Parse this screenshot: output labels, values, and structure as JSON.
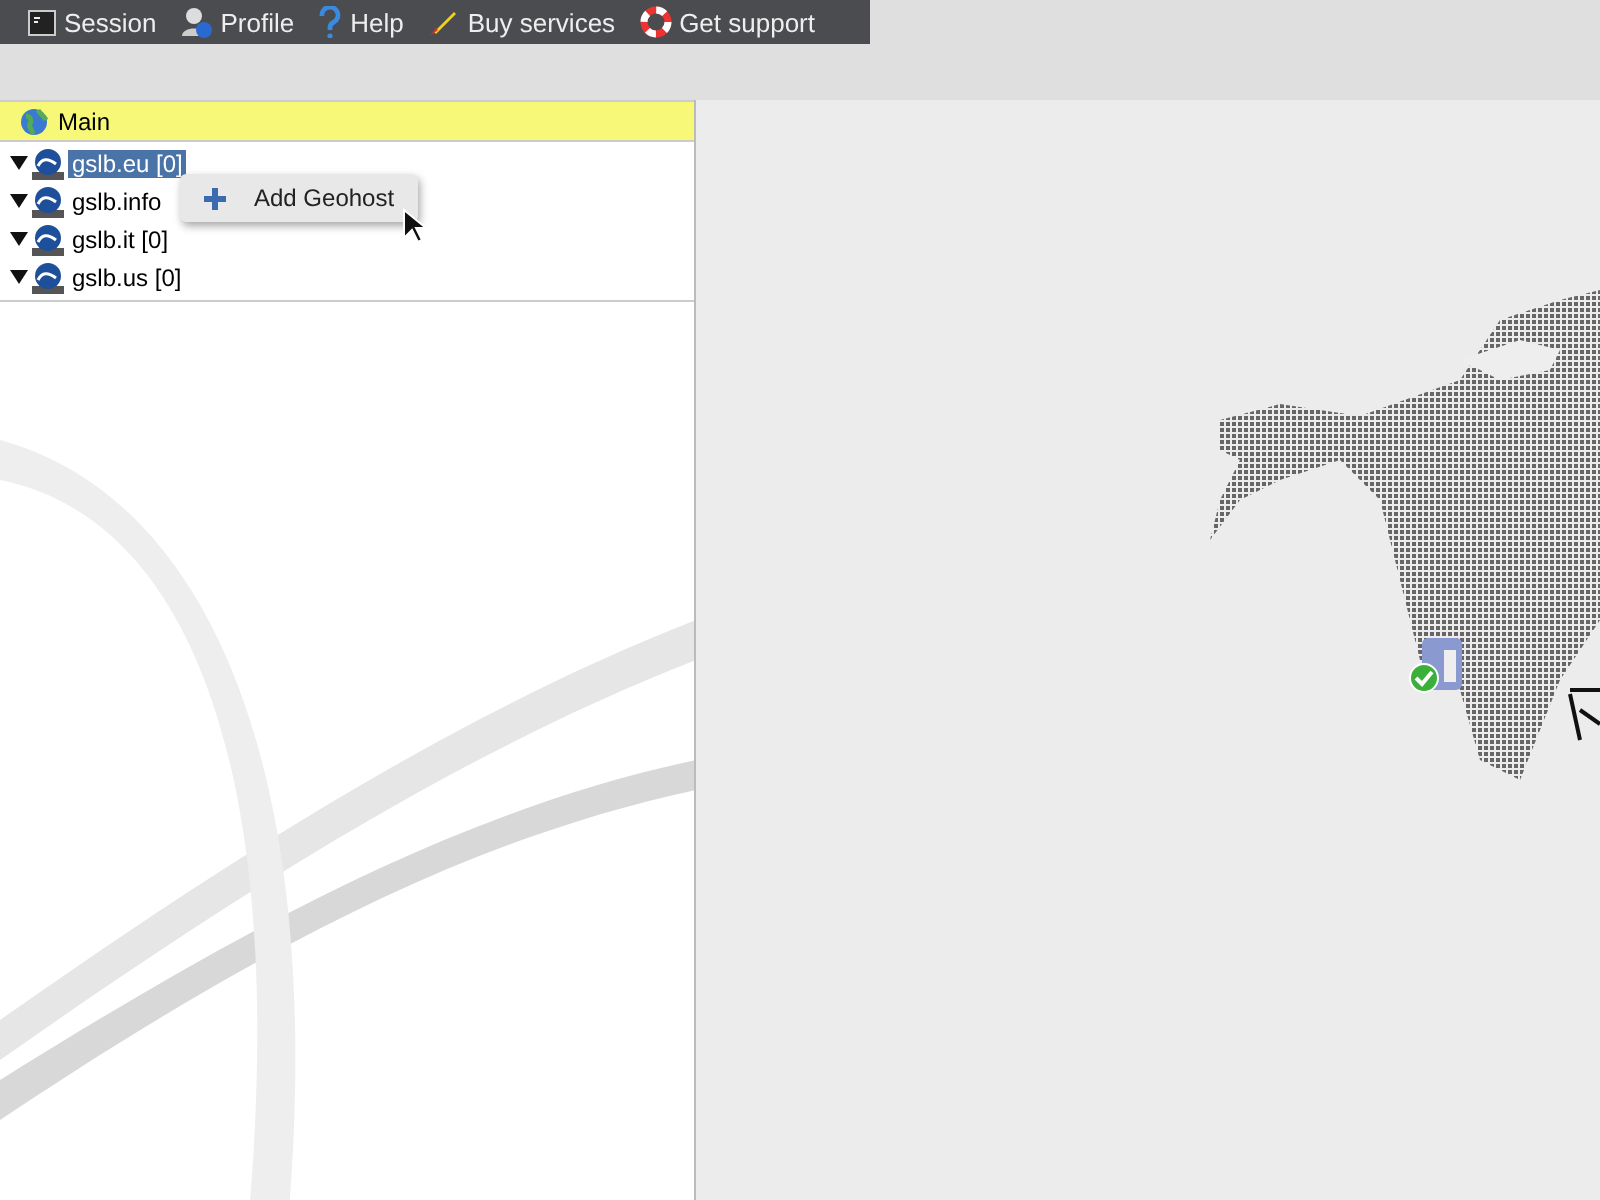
{
  "toolbar": {
    "items": [
      {
        "kind": "session",
        "label": "Session"
      },
      {
        "kind": "profile",
        "label": "Profile"
      },
      {
        "kind": "help",
        "label": "Help"
      },
      {
        "kind": "buy",
        "label": "Buy services"
      },
      {
        "kind": "support",
        "label": "Get support"
      }
    ]
  },
  "tree": {
    "root": "Main",
    "items": [
      {
        "label": "gslb.eu [0]",
        "selected": true,
        "expanded": true
      },
      {
        "label": "gslb.info",
        "selected": false,
        "expanded": true
      },
      {
        "label": "gslb.it [0]",
        "selected": false,
        "expanded": true
      },
      {
        "label": "gslb.us [0]",
        "selected": false,
        "expanded": true
      }
    ]
  },
  "context_menu": {
    "items": [
      "Add Geohost"
    ]
  }
}
